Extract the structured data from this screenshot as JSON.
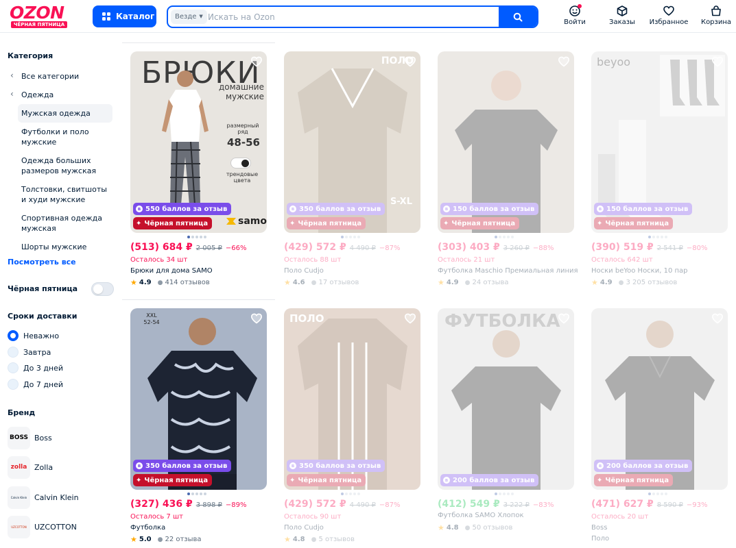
{
  "header": {
    "logo_word": "OZON",
    "logo_tag": "ЧЁРНАЯ ПЯТНИЦА",
    "catalog_label": "Каталог",
    "search_scope": "Везде",
    "search_placeholder": "Искать на Ozon",
    "nav": {
      "login": "Войти",
      "orders": "Заказы",
      "favorites": "Избранное",
      "cart": "Корзина"
    }
  },
  "sidebar": {
    "category_heading": "Категория",
    "categories": {
      "all": "Все категории",
      "clothes": "Одежда",
      "men": "Мужская одежда",
      "tshirts": "Футболки и поло мужские",
      "plus": "Одежда больших размеров мужская",
      "hoodies": "Толстовки, свитшоты и худи мужские",
      "sport": "Спортивная одежда мужская",
      "shorts": "Шорты мужские"
    },
    "see_all": "Посмотреть все",
    "black_friday_label": "Чёрная пятница",
    "black_friday_on": false,
    "delivery_heading": "Сроки доставки",
    "delivery_options": {
      "any": "Неважно",
      "tomorrow": "Завтра",
      "three": "До 3 дней",
      "seven": "До 7 дней"
    },
    "delivery_selected": "Неважно",
    "brand_heading": "Бренд",
    "brands": {
      "boss": "Boss",
      "zolla": "Zolla",
      "ck": "Calvin Klein",
      "uzcotton": "UZCOTTON"
    },
    "brand_logos": {
      "boss": "BOSS",
      "zolla": "zolla",
      "ck": "Calvin Klein",
      "uzcotton": "UZCOTTON"
    }
  },
  "products": {
    "p1": {
      "photo_title": "БРЮКИ",
      "photo_sub": "домашние мужские",
      "photo_size_label": "размерный ряд",
      "photo_size": "48-56",
      "photo_colors": "трендовые цвета",
      "photo_brand": "samo",
      "points": "550 баллов за отзыв",
      "promo": "Чёрная пятница",
      "price": "(513) 684 ₽",
      "old_price": "2 005 ₽",
      "discount": "−66%",
      "stock": "Осталось 34 шт",
      "title": "Брюки для дома SAMO",
      "rating": "4.9",
      "reviews": "414 отзывов"
    },
    "p2": {
      "photo_tag": "ПОЛО",
      "photo_size": "S-XL",
      "points": "350 баллов за отзыв",
      "promo": "Чёрная пятница",
      "price": "(429) 572 ₽",
      "old_price": "4 490 ₽",
      "discount": "−87%",
      "stock": "Осталось 88 шт",
      "title": "Поло Cudjo",
      "rating": "4.6",
      "reviews": "17 отзывов"
    },
    "p3": {
      "points": "150 баллов за отзыв",
      "promo": "Чёрная пятница",
      "price": "(303) 403 ₽",
      "old_price": "3 260 ₽",
      "discount": "−88%",
      "stock": "Осталось 21 шт",
      "title": "Футболка Maschio Премиальная линия",
      "rating": "4.9",
      "reviews": "24 отзыва"
    },
    "p4": {
      "photo_tag": "beyoo",
      "points": "150 баллов за отзыв",
      "promo": "Чёрная пятница",
      "price": "(390) 519 ₽",
      "old_price": "2 541 ₽",
      "discount": "−80%",
      "stock": "Осталось 642 шт",
      "title": "Носки beYoo Носки, 10 пар",
      "rating": "4.9",
      "reviews": "3 205 отзывов"
    },
    "p5": {
      "photo_size": "XXL 52-54",
      "points": "350 баллов за отзыв",
      "promo": "Чёрная пятница",
      "price": "(327) 436 ₽",
      "old_price": "3 898 ₽",
      "discount": "−89%",
      "stock": "Осталось 7 шт",
      "title": "Футболка",
      "rating": "5.0",
      "reviews": "22 отзыва"
    },
    "p6": {
      "photo_tag": "ПОЛО",
      "points": "350 баллов за отзыв",
      "promo": "Чёрная пятница",
      "price": "(429) 572 ₽",
      "old_price": "4 490 ₽",
      "discount": "−87%",
      "stock": "Осталось 90 шт",
      "title": "Поло Cudjo",
      "rating": "4.8",
      "reviews": "5 отзывов"
    },
    "p7": {
      "photo_tag": "ФУТБОЛКА",
      "points": "200 баллов за отзыв",
      "promo": "Чёрная пятница",
      "price": "(412) 549 ₽",
      "old_price": "3 222 ₽",
      "discount": "−83%",
      "stock": "",
      "title": "Футболка SAMO Хлопок",
      "rating": "4.8",
      "reviews": "50 отзывов"
    },
    "p8": {
      "points": "200 баллов за отзыв",
      "promo": "Чёрная пятница",
      "price": "(471) 627 ₽",
      "old_price": "8 590 ₽",
      "discount": "−93%",
      "stock": "Осталось 20 шт",
      "title": "Boss",
      "subtitle": "Поло"
    }
  },
  "colors": {
    "brand": "#005bff",
    "accent": "#f91155",
    "points": "#7a4dea",
    "promo": "#c5102b"
  }
}
